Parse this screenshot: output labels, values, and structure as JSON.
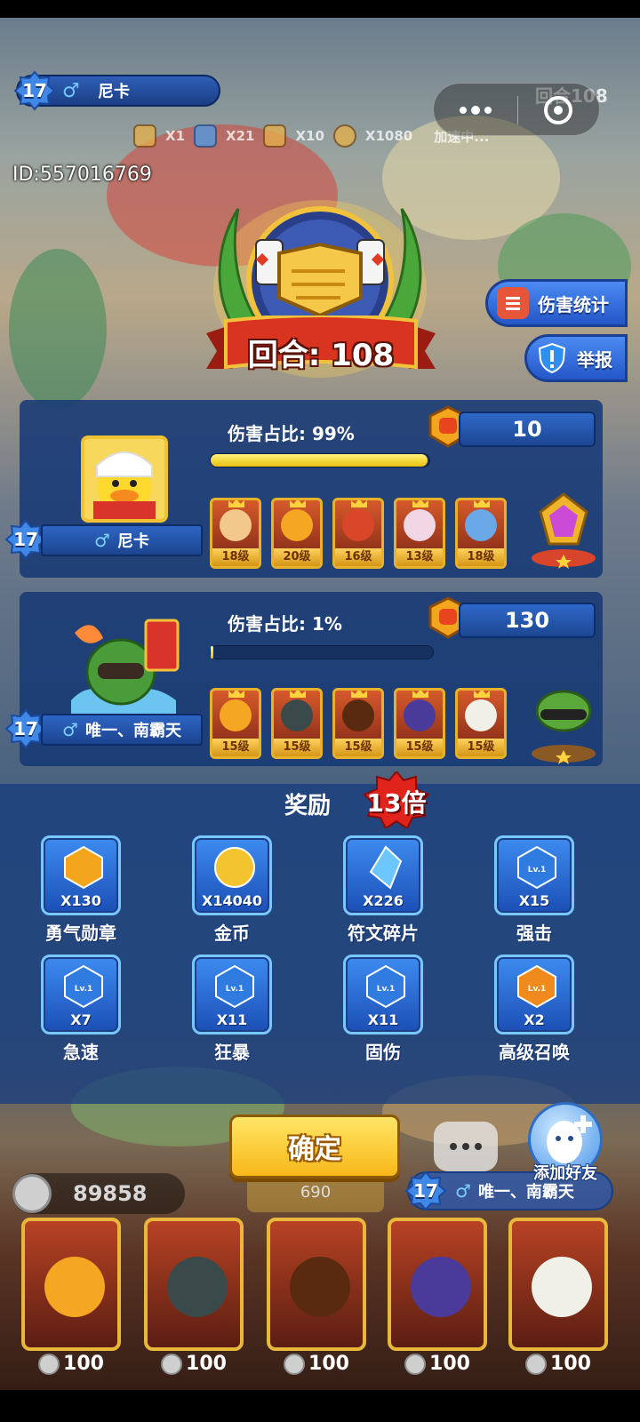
{
  "hud": {
    "level": "17",
    "player_name": "尼卡",
    "round_label": "回合108",
    "counters": [
      "X1",
      "X21",
      "X10",
      "X1080"
    ],
    "speed_label": "加速中..."
  },
  "player_id": "ID:557016769",
  "side_buttons": {
    "damage_stats": "伤害统计",
    "report": "举报"
  },
  "round": {
    "text": "回合: 108"
  },
  "players": [
    {
      "level": "17",
      "gender": "♂",
      "name": "尼卡",
      "damage_label": "伤害占比: 99%",
      "damage_share": 0.99,
      "medals": "10",
      "heroes": [
        {
          "level": "18级",
          "color": "#f3c98b"
        },
        {
          "level": "20级",
          "color": "#f5a623"
        },
        {
          "level": "16级",
          "color": "#d9462a"
        },
        {
          "level": "13级",
          "color": "#f1d6e6"
        },
        {
          "level": "18级",
          "color": "#6aa8e8"
        }
      ]
    },
    {
      "level": "17",
      "gender": "♂",
      "name": "唯一、南霸天",
      "damage_label": "伤害占比: 1%",
      "damage_share": 0.01,
      "medals": "130",
      "heroes": [
        {
          "level": "15级",
          "color": "#f5a623"
        },
        {
          "level": "15级",
          "color": "#3a4a4a"
        },
        {
          "level": "15级",
          "color": "#5a2a10"
        },
        {
          "level": "15级",
          "color": "#4a3a9a"
        },
        {
          "level": "15级",
          "color": "#f0f0e8"
        }
      ]
    }
  ],
  "reward": {
    "title": "奖励",
    "multiplier": "13倍",
    "items": [
      {
        "qty": "X130",
        "label": "勇气勋章",
        "icon": "fist-medal-icon",
        "color": "#f2a51d"
      },
      {
        "qty": "X14040",
        "label": "金币",
        "icon": "gold-coin-icon",
        "color": "#f4c430"
      },
      {
        "qty": "X226",
        "label": "符文碎片",
        "icon": "rune-crystal-icon",
        "color": "#6cc7ff"
      },
      {
        "qty": "X15",
        "label": "强击",
        "icon": "power-strike-icon",
        "color": "#2f7be0",
        "tag": "Lv.1"
      },
      {
        "qty": "X7",
        "label": "急速",
        "icon": "haste-icon",
        "color": "#2f7be0",
        "tag": "Lv.1"
      },
      {
        "qty": "X11",
        "label": "狂暴",
        "icon": "berserk-icon",
        "color": "#2f7be0",
        "tag": "Lv.1"
      },
      {
        "qty": "X11",
        "label": "固伤",
        "icon": "fixed-damage-icon",
        "color": "#2f7be0",
        "tag": "Lv.1"
      },
      {
        "qty": "X2",
        "label": "高级召唤",
        "icon": "advanced-summon-icon",
        "color": "#f08a1c",
        "tag": "Lv.1"
      }
    ]
  },
  "confirm_label": "确定",
  "add_friend_label": "添加好友",
  "bottom": {
    "coins": "89858",
    "mid_value": "690",
    "opponent_level": "17",
    "opponent_name": "唯一、南霸天",
    "deck_costs": [
      "100",
      "100",
      "100",
      "100",
      "100"
    ]
  }
}
